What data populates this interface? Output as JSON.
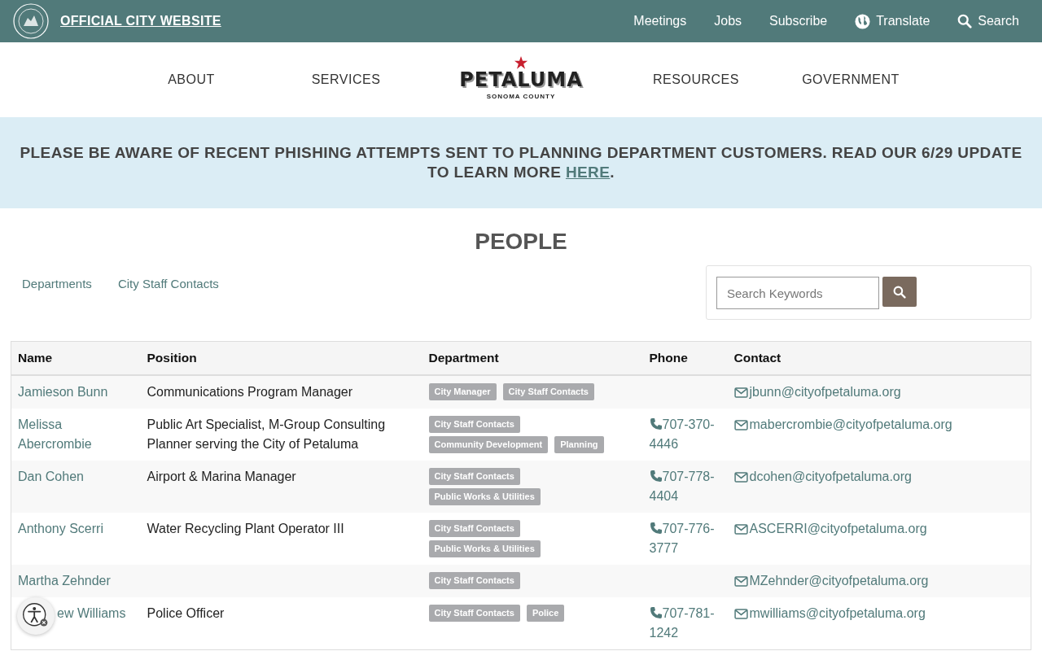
{
  "top_bar": {
    "site_link": "OFFICIAL CITY WEBSITE",
    "links": [
      "Meetings",
      "Jobs",
      "Subscribe"
    ],
    "translate": "Translate",
    "search": "Search"
  },
  "main_nav": {
    "left": [
      "ABOUT",
      "SERVICES"
    ],
    "logo": {
      "name": "PETALUMA",
      "subtitle": "SONOMA COUNTY"
    },
    "right": [
      "RESOURCES",
      "GOVERNMENT"
    ]
  },
  "alert": {
    "text": "PLEASE BE AWARE OF RECENT PHISHING ATTEMPTS SENT TO PLANNING DEPARTMENT CUSTOMERS. READ OUR 6/29 UPDATE TO LEARN MORE",
    "link": "HERE",
    "end": "."
  },
  "page_title": "PEOPLE",
  "sub_nav": [
    "Departments",
    "City Staff Contacts"
  ],
  "search": {
    "placeholder": "Search Keywords"
  },
  "table": {
    "columns": [
      "Name",
      "Position",
      "Department",
      "Phone",
      "Contact"
    ],
    "rows": [
      {
        "name": "Jamieson Bunn",
        "position": "Communications Program Manager",
        "departments": [
          "City Manager",
          "City Staff Contacts"
        ],
        "phone": "",
        "email": "jbunn@cityofpetaluma.org",
        "covered": false
      },
      {
        "name": "Melissa Abercrombie",
        "position": "Public Art Specialist, M-Group Consulting Planner serving the City of Petaluma",
        "departments": [
          "City Staff Contacts",
          "Community Development",
          "Planning"
        ],
        "phone": "707-370-4446",
        "email": "mabercrombie@cityofpetaluma.org",
        "covered": false
      },
      {
        "name": "Dan Cohen",
        "position": "Airport & Marina Manager",
        "departments": [
          "City Staff Contacts",
          "Public Works & Utilities"
        ],
        "phone": "707-778-4404",
        "email": "dcohen@cityofpetaluma.org",
        "covered": false
      },
      {
        "name": "Anthony Scerri",
        "position": "Water Recycling Plant Operator III",
        "departments": [
          "City Staff Contacts",
          "Public Works & Utilities"
        ],
        "phone": "707-776-3777",
        "email": "ASCERRI@cityofpetaluma.org",
        "covered": false
      },
      {
        "name": "Martha Zehnder",
        "position": "",
        "departments": [
          "City Staff Contacts"
        ],
        "phone": "",
        "email": "MZehnder@cityofpetaluma.org",
        "covered": false
      },
      {
        "name": "ew Williams",
        "position": "Police Officer",
        "departments": [
          "City Staff Contacts",
          "Police"
        ],
        "phone": "707-781-1242",
        "email": "mwilliams@cityofpetaluma.org",
        "covered": true
      }
    ]
  }
}
